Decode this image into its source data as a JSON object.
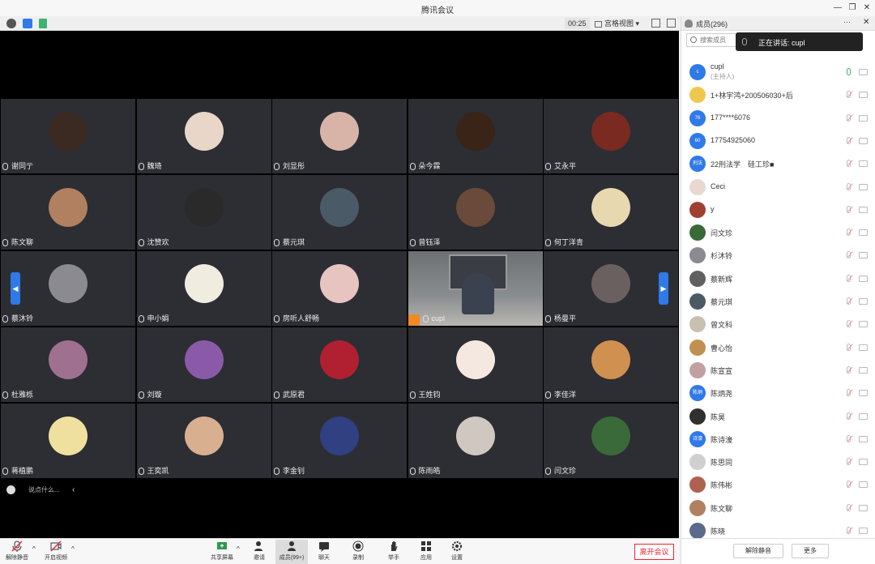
{
  "window": {
    "title": "腾讯会议"
  },
  "toolbar": {
    "timer": "00:25",
    "layout_label": "宫格视图",
    "layout_caret": "▾"
  },
  "gallery": {
    "tiles": [
      {
        "name": "谢同亍",
        "color": "#3a2a22"
      },
      {
        "name": "魏琦",
        "color": "#e8d6c8"
      },
      {
        "name": "刘显彤",
        "color": "#d8b4a8"
      },
      {
        "name": "朵今霖",
        "color": "#3a2418"
      },
      {
        "name": "艾永平",
        "color": "#7a2a20"
      },
      {
        "name": "陈文聊",
        "color": "#b08060"
      },
      {
        "name": "沈赞欢",
        "color": "#2a2a2a"
      },
      {
        "name": "蔡元琪",
        "color": "#4a5a66"
      },
      {
        "name": "曾钰泽",
        "color": "#6a4a3a"
      },
      {
        "name": "何丁洋青",
        "color": "#e8d8b0"
      },
      {
        "name": "蔡沐铃",
        "color": "#8a8a90"
      },
      {
        "name": "申小娟",
        "color": "#f0ece0"
      },
      {
        "name": "房听人舒畅",
        "color": "#e8c4c0"
      },
      {
        "name": "cupl",
        "color": "#8a8a8a",
        "is_video": true
      },
      {
        "name": "杨曼平",
        "color": "#6a6060"
      },
      {
        "name": "杜雅栎",
        "color": "#a07090"
      },
      {
        "name": "刘璇",
        "color": "#8a5aa8"
      },
      {
        "name": "武原君",
        "color": "#b02030"
      },
      {
        "name": "王姓钧",
        "color": "#f4e8e0"
      },
      {
        "name": "李佳洋",
        "color": "#d09050"
      },
      {
        "name": "蒋植鹏",
        "color": "#f0e0a0"
      },
      {
        "name": "王奕凯",
        "color": "#d8b090"
      },
      {
        "name": "李金钊",
        "color": "#304080"
      },
      {
        "name": "陈雨皓",
        "color": "#d0c8c0"
      },
      {
        "name": "闫文珍",
        "color": "#3a6a3a"
      }
    ],
    "prev_arrow": "◀",
    "next_arrow": "▶"
  },
  "chat": {
    "placeholder": "说点什么...",
    "collapse": "‹"
  },
  "controls": {
    "mute_label": "解除静音",
    "video_label": "开启视频",
    "share_label": "共享屏幕",
    "invite_label": "邀请",
    "members_label": "成员(99+)",
    "chat_label": "聊天",
    "record_label": "录制",
    "hand_label": "举手",
    "apps_label": "应用",
    "settings_label": "设置",
    "caret": "^",
    "end_label": "离开会议"
  },
  "panel": {
    "title": "成员(296)",
    "more": "···",
    "close": "✕",
    "search_placeholder": "搜索成员",
    "speaking": "正在讲话: cupl",
    "members": [
      {
        "name": "cupl",
        "role": "(主持人)",
        "avatar_text": "c",
        "color": "#2f79e8",
        "mic": "on"
      },
      {
        "name": "1+林宇鸿+200506030+后",
        "avatar_text": "",
        "color": "#f0c850",
        "mic": "off"
      },
      {
        "name": "177****6076",
        "avatar_text": "76",
        "color": "#2f79e8",
        "mic": "off"
      },
      {
        "name": "17754925060",
        "avatar_text": "60",
        "color": "#2f79e8",
        "mic": "off"
      },
      {
        "name": "22刑法学　硅工珍■",
        "avatar_text": "刑法",
        "color": "#2f79e8",
        "mic": "off"
      },
      {
        "name": "Ceci",
        "avatar_text": "",
        "color": "#e8d8d0",
        "mic": "off"
      },
      {
        "name": "y",
        "avatar_text": "",
        "color": "#a04030",
        "mic": "off"
      },
      {
        "name": "闫文珍",
        "avatar_text": "",
        "color": "#3a6a3a",
        "mic": "off"
      },
      {
        "name": "杉沐铃",
        "avatar_text": "",
        "color": "#8a8a90",
        "mic": "off"
      },
      {
        "name": "蔡新辉",
        "avatar_text": "",
        "color": "#606060",
        "mic": "off"
      },
      {
        "name": "蔡元琪",
        "avatar_text": "",
        "color": "#4a5a66",
        "mic": "off"
      },
      {
        "name": "曾文科",
        "avatar_text": "",
        "color": "#c8c0b0",
        "mic": "off"
      },
      {
        "name": "曹心怡",
        "avatar_text": "",
        "color": "#c09050",
        "mic": "off"
      },
      {
        "name": "陈宣宣",
        "avatar_text": "",
        "color": "#c0a0a0",
        "mic": "off"
      },
      {
        "name": "陈炳尧",
        "avatar_text": "陈炳",
        "color": "#2f79e8",
        "mic": "off"
      },
      {
        "name": "陈昊",
        "avatar_text": "",
        "color": "#303030",
        "mic": "off"
      },
      {
        "name": "陈诗濠",
        "avatar_text": "诗濠",
        "color": "#2f79e8",
        "mic": "off"
      },
      {
        "name": "陈思同",
        "avatar_text": "",
        "color": "#d0d0d0",
        "mic": "off"
      },
      {
        "name": "陈伟彬",
        "avatar_text": "",
        "color": "#b06050",
        "mic": "off"
      },
      {
        "name": "陈文聊",
        "avatar_text": "",
        "color": "#b08060",
        "mic": "off"
      },
      {
        "name": "陈晓",
        "avatar_text": "",
        "color": "#5a6a8a",
        "mic": "off"
      }
    ],
    "unmute_all_label": "解除静音",
    "more_label": "更多"
  }
}
